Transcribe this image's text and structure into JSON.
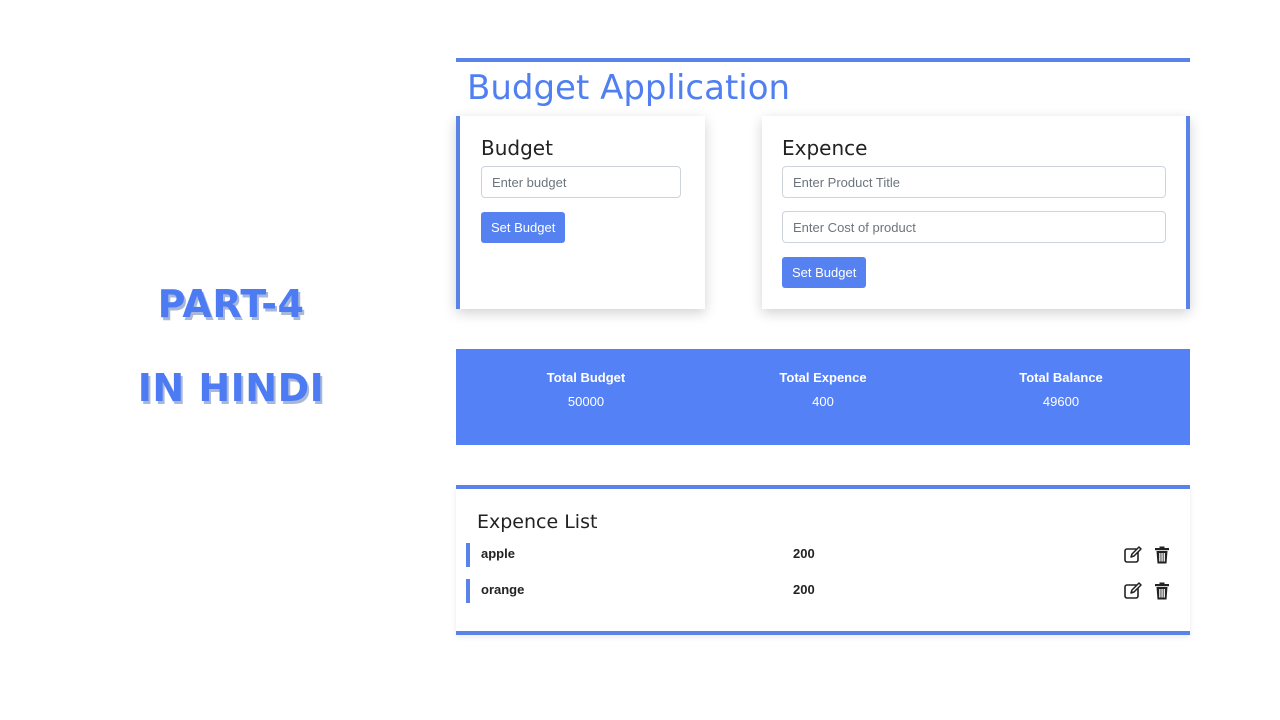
{
  "promo": {
    "line1": "PART-4",
    "line2": "IN HINDI"
  },
  "app": {
    "title": "Budget Application"
  },
  "budget_card": {
    "heading": "Budget",
    "budget_placeholder": "Enter budget",
    "button_label": "Set Budget"
  },
  "expence_card": {
    "heading": "Expence",
    "title_placeholder": "Enter Product Title",
    "cost_placeholder": "Enter Cost of product",
    "button_label": "Set Budget"
  },
  "totals": {
    "budget_label": "Total Budget",
    "budget_value": "50000",
    "expence_label": "Total Expence",
    "expence_value": "400",
    "balance_label": "Total Balance",
    "balance_value": "49600"
  },
  "expence_list": {
    "heading": "Expence List",
    "items": [
      {
        "name": "apple",
        "cost": "200",
        "edit_icon": "edit-icon",
        "delete_icon": "trash-icon"
      },
      {
        "name": "orange",
        "cost": "200",
        "edit_icon": "edit-icon",
        "delete_icon": "trash-icon"
      }
    ]
  },
  "colors": {
    "accent": "#5581f6",
    "title": "#4f7ff0",
    "promo_text": "#4c7bf3"
  }
}
